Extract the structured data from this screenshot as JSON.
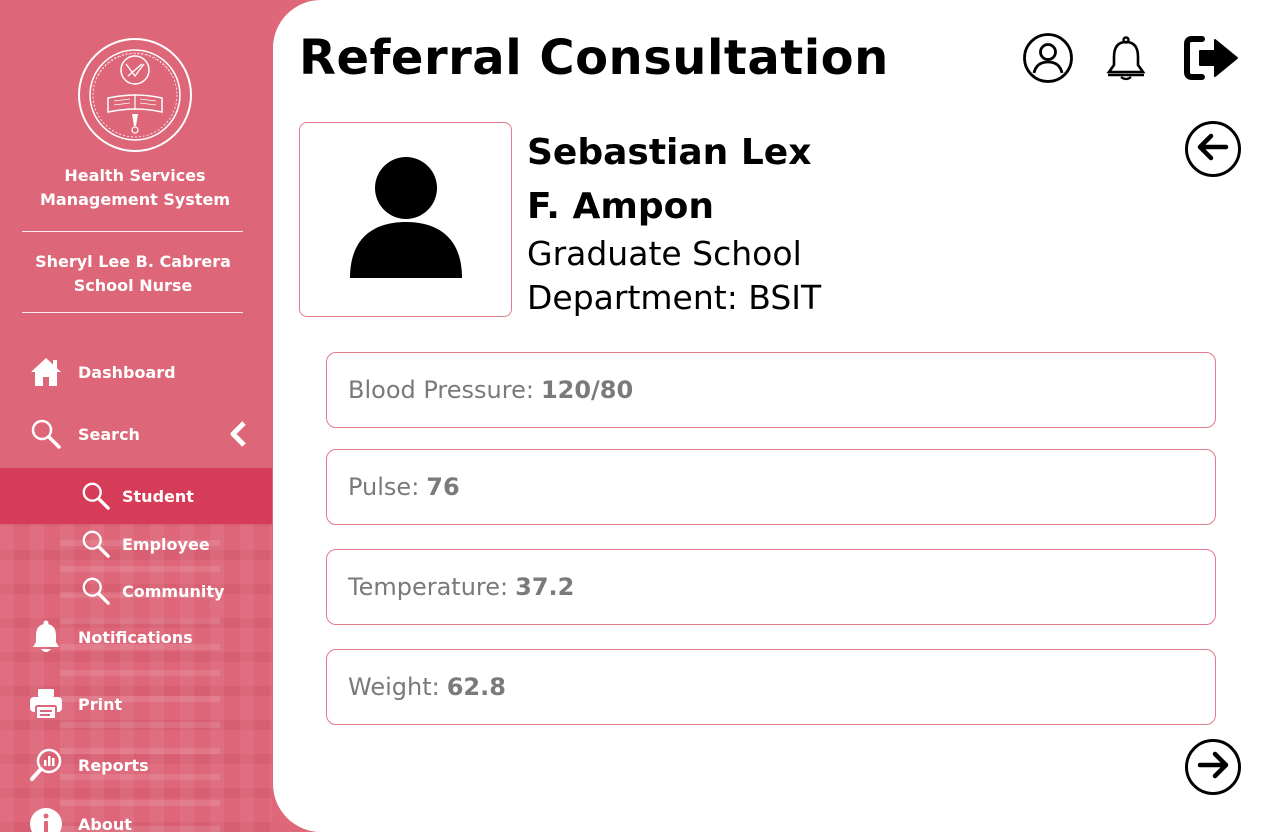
{
  "sidebar": {
    "app_title_line1": "Health Services",
    "app_title_line2": "Management System",
    "user_name": "Sheryl Lee B. Cabrera",
    "user_role": "School Nurse",
    "nav": {
      "dashboard": "Dashboard",
      "search": "Search",
      "student": "Student",
      "employee": "Employee",
      "community": "Community",
      "notifications": "Notifications",
      "print": "Print",
      "reports": "Reports",
      "about": "About"
    }
  },
  "header": {
    "title": "Referral Consultation",
    "icons": [
      "user-circle-icon",
      "bell-icon",
      "logout-icon"
    ]
  },
  "patient": {
    "name_line1": "Sebastian Lex",
    "name_line2": "F. Ampon",
    "school": "Graduate School",
    "department": "Department: BSIT"
  },
  "vitals": {
    "blood_pressure_label": "Blood Pressure:",
    "blood_pressure_value": "120/80",
    "pulse_label": "Pulse:",
    "pulse_value": "76",
    "temperature_label": "Temperature:",
    "temperature_value": "37.2",
    "weight_label": "Weight:",
    "weight_value": "62.8"
  },
  "colors": {
    "sidebar_bg": "#dd6678",
    "active_item": "#d63c58",
    "card_border": "#e27b8b",
    "value_text": "#7a7a7a"
  }
}
